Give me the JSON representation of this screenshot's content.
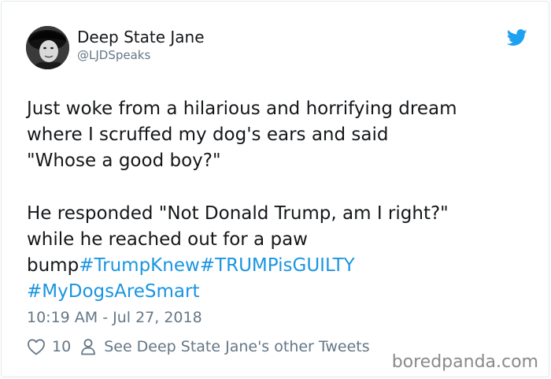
{
  "author": {
    "display_name": "Deep State Jane",
    "handle": "@LJDSpeaks"
  },
  "tweet": {
    "lines": [
      "Just woke from a hilarious and horrifying dream",
      "where I scruffed my dog's ears and said",
      "\"Whose a good boy?\"",
      "He responded \"Not Donald Trump, am I right?\"",
      "while he reached out for a paw",
      "bump"
    ],
    "hashtags": [
      "#TrumpKnew",
      "#TRUMPisGUILTY",
      "#MyDogsAreSmart"
    ]
  },
  "timestamp": "10:19 AM - Jul 27, 2018",
  "actions": {
    "like_count": "10",
    "other_tweets_label": "See Deep State Jane's other Tweets"
  },
  "icons": {
    "brand": "twitter-bird-icon",
    "like": "heart-icon",
    "profile": "person-icon"
  },
  "colors": {
    "link": "#1b95e0",
    "secondary_text": "#657786",
    "twitter_blue": "#1da1f2"
  },
  "watermark": "boredpanda.com"
}
